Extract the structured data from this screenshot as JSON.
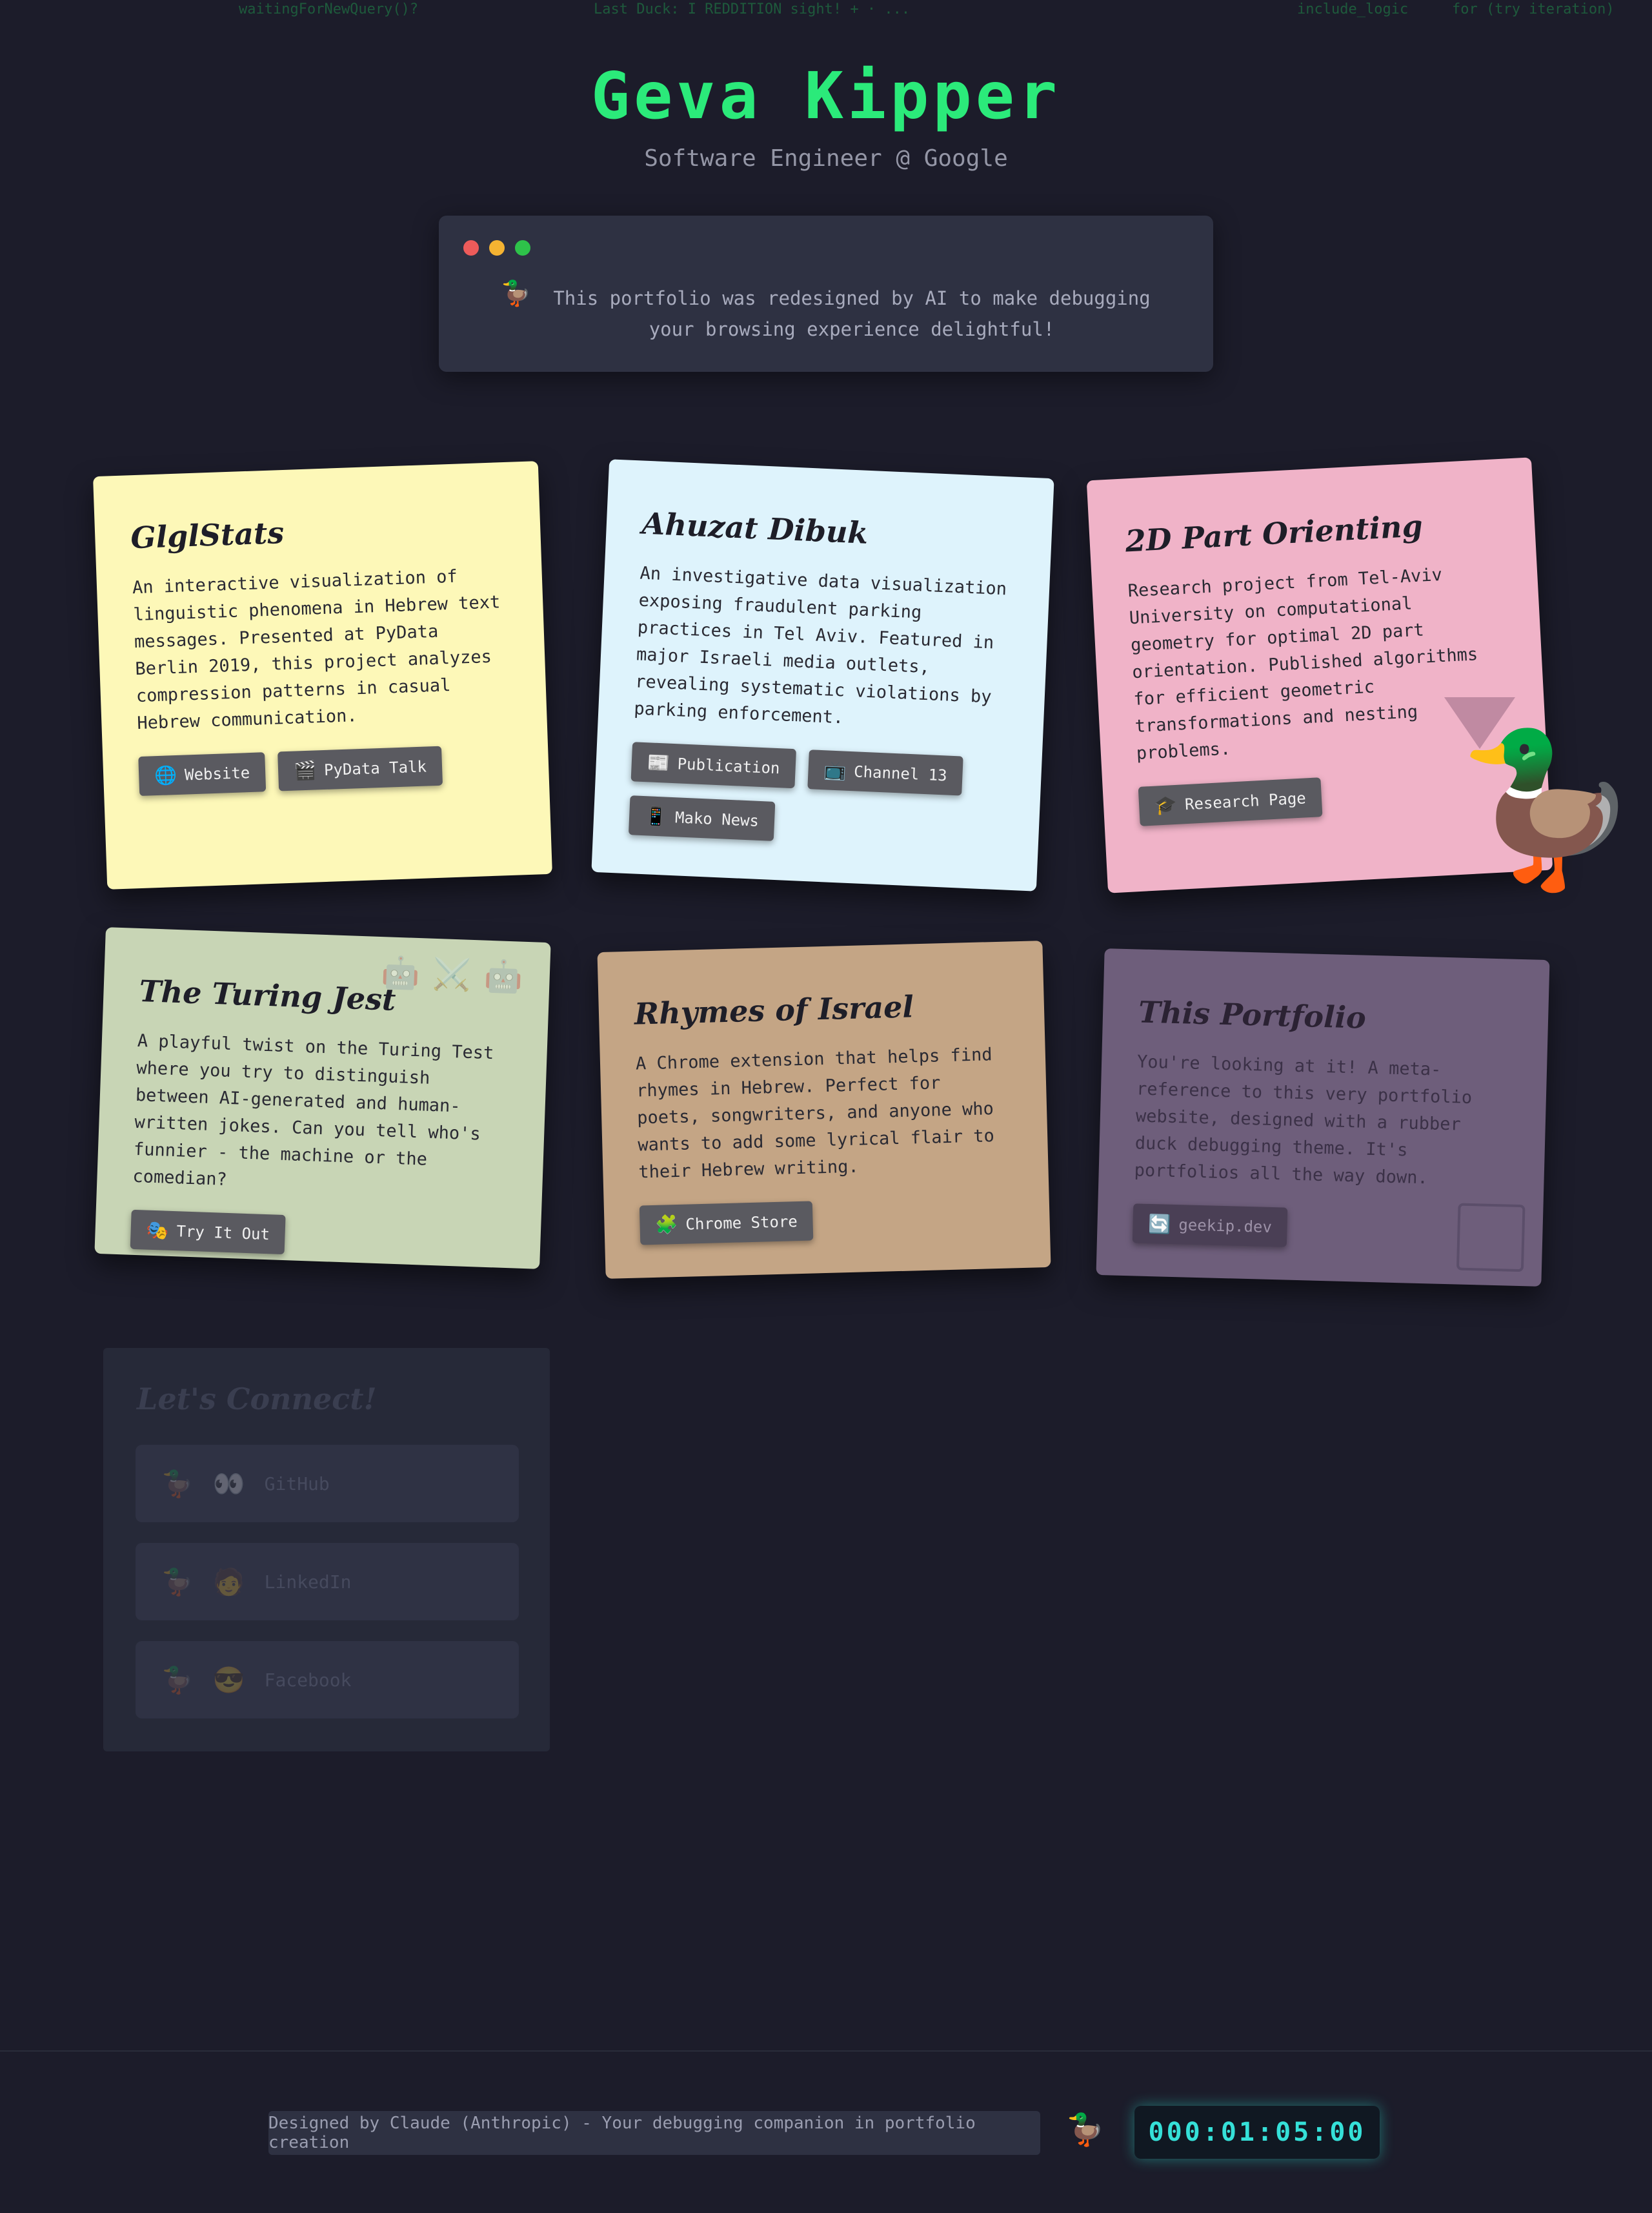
{
  "ticker": [
    "waitingForNewQuery()?",
    "Last Duck: I REDDITION sight! + · ...",
    "include_logic",
    "for (try iteration)"
  ],
  "header": {
    "name": "Geva Kipper",
    "subtitle": "Software Engineer @ Google"
  },
  "terminal": {
    "icon": "🦆",
    "message": "This portfolio was redesigned by AI to make debugging your browsing experience delightful!",
    "dot_colors": [
      "#ed5b5a",
      "#f5b332",
      "#2ec24a"
    ]
  },
  "projects": [
    {
      "title": "GlglStats",
      "description": "An interactive visualization of linguistic phenomena in Hebrew text messages. Presented at PyData Berlin 2019, this project analyzes compression patterns in casual Hebrew communication.",
      "color": "#fdf8b8",
      "links": [
        {
          "icon": "🌐",
          "label": "Website"
        },
        {
          "icon": "🎬",
          "label": "PyData Talk"
        }
      ]
    },
    {
      "title": "Ahuzat Dibuk",
      "description": "An investigative data visualization exposing fraudulent parking practices in Tel Aviv. Featured in major Israeli media outlets, revealing systematic violations by parking enforcement.",
      "color": "#def3fc",
      "links": [
        {
          "icon": "📰",
          "label": "Publication"
        },
        {
          "icon": "📺",
          "label": "Channel 13"
        },
        {
          "icon": "📱",
          "label": "Mako News"
        }
      ]
    },
    {
      "title": "2D Part Orienting",
      "description": "Research project from Tel-Aviv University on computational geometry for optimal 2D part orientation. Published algorithms for efficient geometric transformations and nesting problems.",
      "color": "#f0b3c8",
      "links": [
        {
          "icon": "🎓",
          "label": "Research Page"
        }
      ]
    },
    {
      "title": "The Turing Jest",
      "description": "A playful twist on the Turing Test where you try to distinguish between AI-generated and human-written jokes. Can you tell who's funnier - the machine or the comedian?",
      "color": "#c8d5b5",
      "decor": "🤖⚔️🤖",
      "links": [
        {
          "icon": "🎭",
          "label": "Try It Out"
        }
      ]
    },
    {
      "title": "Rhymes of Israel",
      "description": "A Chrome extension that helps find rhymes in Hebrew. Perfect for poets, songwriters, and anyone who wants to add some lyrical flair to their Hebrew writing.",
      "color": "#c4a585",
      "links": [
        {
          "icon": "🧩",
          "label": "Chrome Store"
        }
      ]
    },
    {
      "title": "This Portfolio",
      "description": "You're looking at it! A meta-reference to this very portfolio website, designed with a rubber duck debugging theme. It's portfolios all the way down.",
      "color": "#6e5e7b",
      "links": [
        {
          "icon": "🔄",
          "label": "geekip.dev"
        }
      ]
    }
  ],
  "connect": {
    "title": "Let's Connect!",
    "items": [
      {
        "icon": "🦆",
        "icon2": "👀",
        "label": "GitHub"
      },
      {
        "icon": "🦆",
        "icon2": "🧑",
        "label": "LinkedIn"
      },
      {
        "icon": "🦆",
        "icon2": "😎",
        "label": "Facebook"
      }
    ]
  },
  "footer": {
    "credit": "Designed by Claude (Anthropic) - Your debugging companion in portfolio creation",
    "duck": "🦆",
    "timer": "000:01:05:00"
  },
  "mascot": "🦆"
}
